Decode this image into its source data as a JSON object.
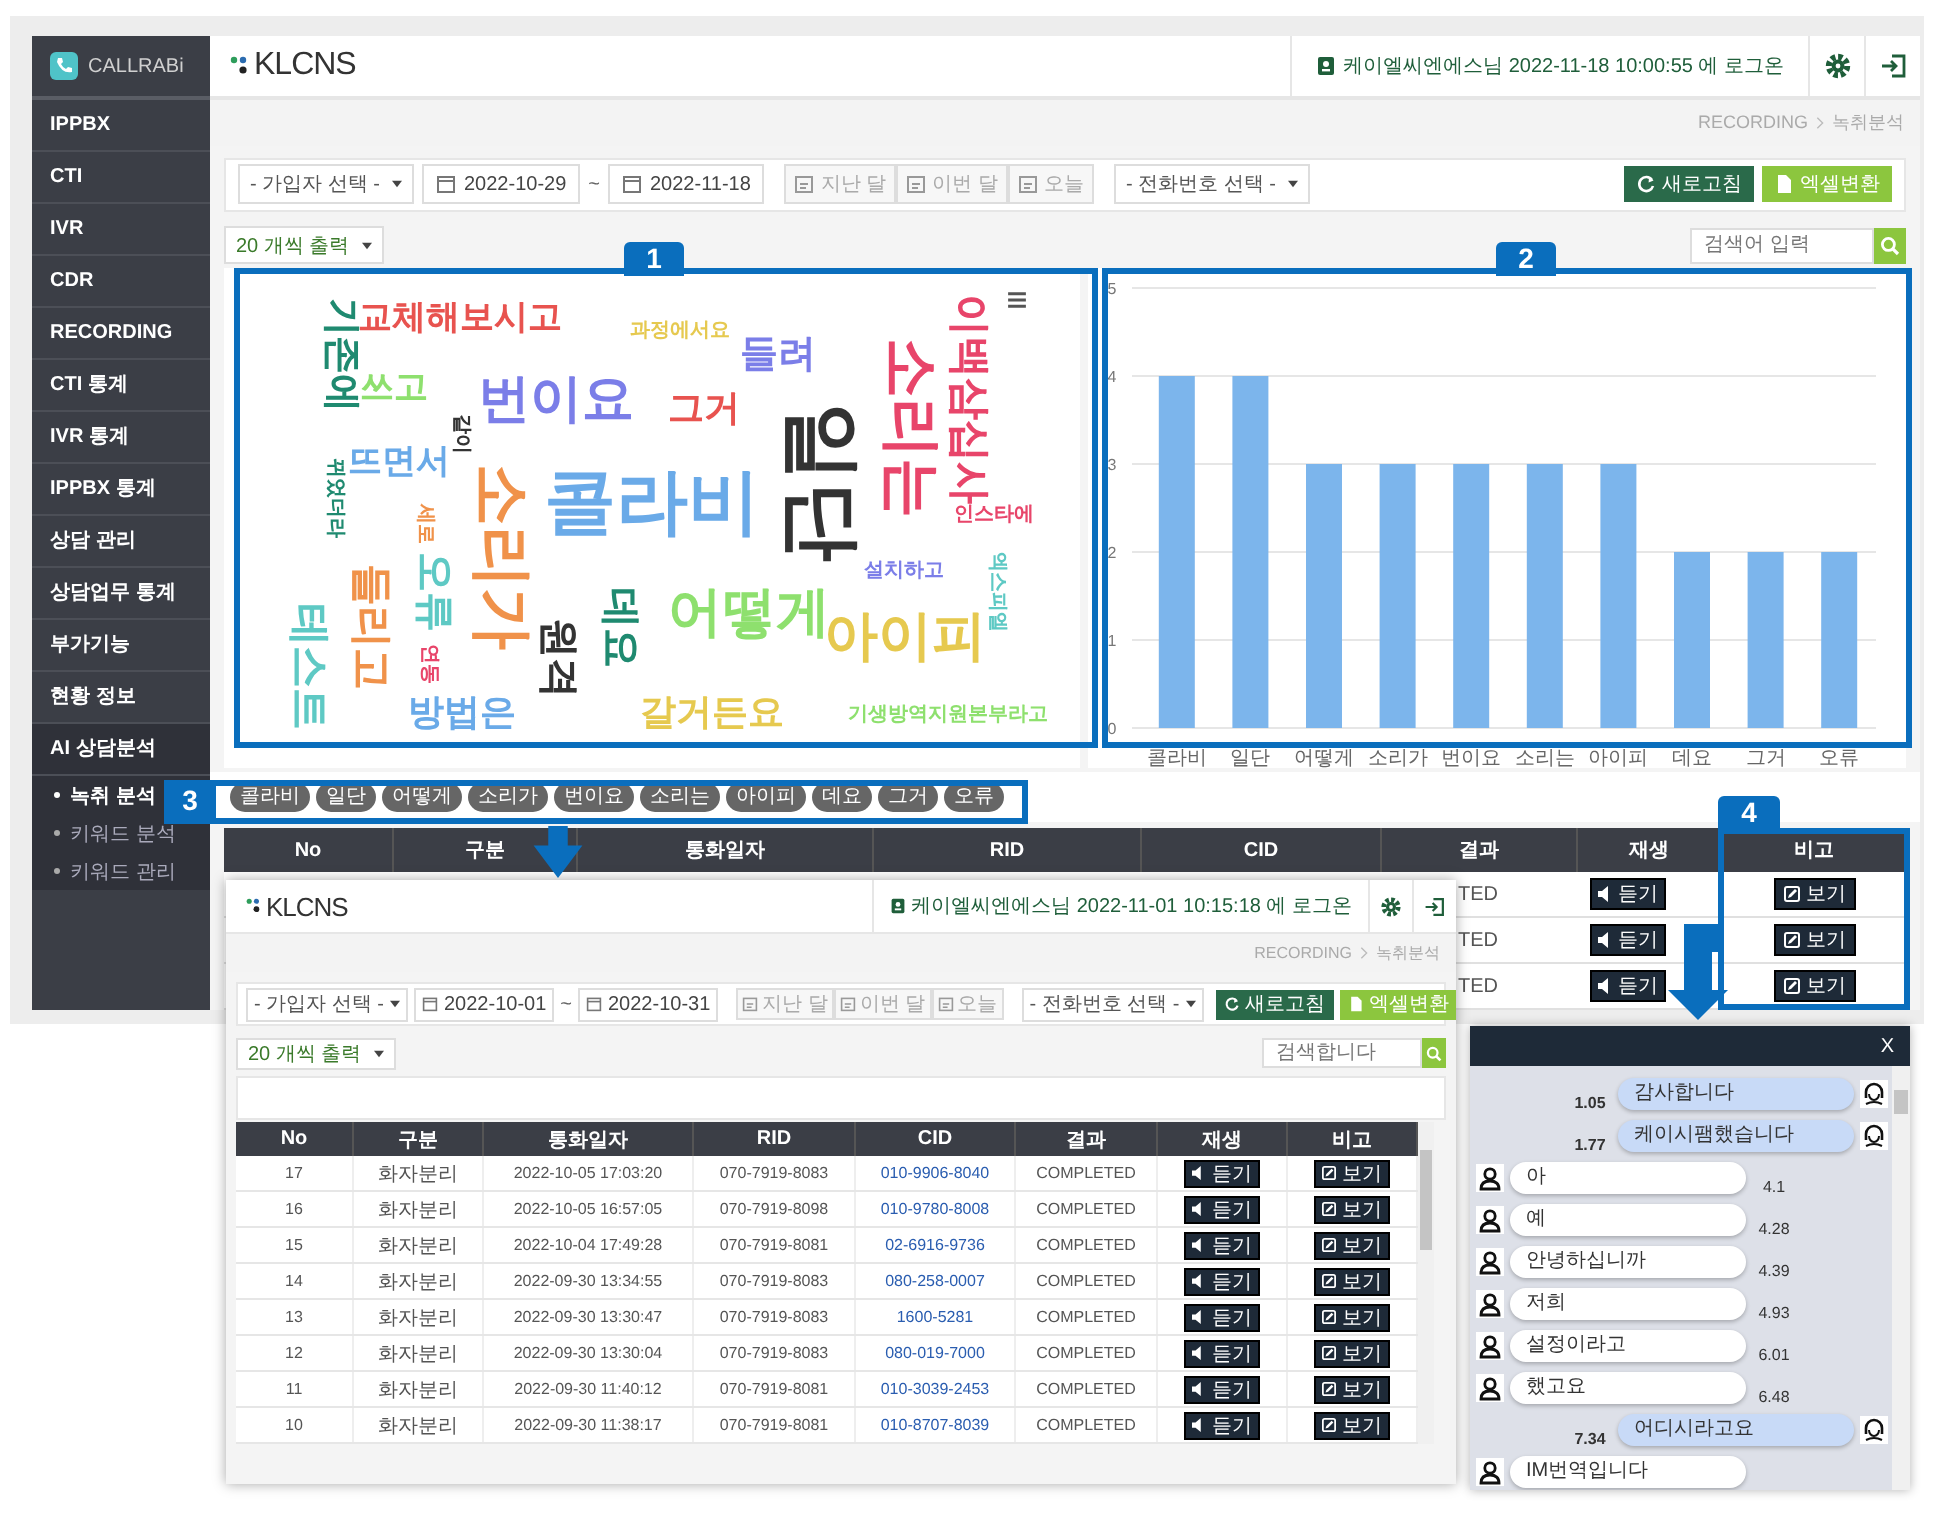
{
  "sidebar": {
    "brand": "CALLRABi",
    "items": [
      {
        "label": "IPPBX",
        "expanded": false
      },
      {
        "label": "CTI",
        "expanded": false
      },
      {
        "label": "IVR",
        "expanded": false
      },
      {
        "label": "CDR",
        "expanded": false
      },
      {
        "label": "RECORDING",
        "expanded": false
      },
      {
        "label": "CTI 통계",
        "expanded": false
      },
      {
        "label": "IVR 통계",
        "expanded": false
      },
      {
        "label": "IPPBX 통계",
        "expanded": false
      },
      {
        "label": "상담 관리",
        "expanded": false
      },
      {
        "label": "상담업무 통계",
        "expanded": false
      },
      {
        "label": "부가기능",
        "expanded": false
      },
      {
        "label": "현황 정보",
        "expanded": false
      },
      {
        "label": "AI 상담분석",
        "expanded": true,
        "children": [
          {
            "label": "녹취 분석",
            "selected": true
          },
          {
            "label": "키워드 분석",
            "selected": false
          },
          {
            "label": "키워드 관리",
            "selected": false
          }
        ]
      }
    ]
  },
  "header": {
    "logo": "KLCNS",
    "user": "케이엘씨엔에스님 2022-11-18 10:00:55 에 로그온"
  },
  "breadcrumb": [
    "RECORDING",
    "녹취분석"
  ],
  "filters": {
    "member_select": "- 가입자 선택 -",
    "date_from": "2022-10-29",
    "date_sep": "~",
    "date_to": "2022-11-18",
    "quick_buttons": [
      "지난 달",
      "이번 달",
      "오늘"
    ],
    "phone_select": "- 전화번호 선택 -",
    "refresh": "새로고침",
    "excel": "엑셀변환"
  },
  "page_size": "20 개씩 출력",
  "search": {
    "placeholder": "검색어 입력"
  },
  "word_cloud": {
    "words": [
      {
        "text": "교체해보시고",
        "color": "#e8534f",
        "vertical": false
      },
      {
        "text": "기존에",
        "color": "#1f8a70",
        "vertical": true
      },
      {
        "text": "쓰고",
        "color": "#8ee06e",
        "vertical": false
      },
      {
        "text": "번이요",
        "color": "#7b7ee8",
        "vertical": false
      },
      {
        "text": "과정에서요",
        "color": "#e6c94f",
        "vertical": false
      },
      {
        "text": "그거",
        "color": "#e8534f",
        "vertical": false
      },
      {
        "text": "들려",
        "color": "#7b7ee8",
        "vertical": false
      },
      {
        "text": "이백삼십사",
        "color": "#e8456a",
        "vertical": true
      },
      {
        "text": "소리는",
        "color": "#e8456a",
        "vertical": true
      },
      {
        "text": "일단",
        "color": "#333333",
        "vertical": true
      },
      {
        "text": "콜라비",
        "color": "#6aaae8",
        "vertical": false
      },
      {
        "text": "같이",
        "color": "#333333",
        "vertical": true
      },
      {
        "text": "뜨면서",
        "color": "#6aaae8",
        "vertical": false
      },
      {
        "text": "뀌었더라",
        "color": "#1f8a70",
        "vertical": true
      },
      {
        "text": "소리가",
        "color": "#f0924a",
        "vertical": true
      },
      {
        "text": "세로",
        "color": "#f0924a",
        "vertical": true
      },
      {
        "text": "오류",
        "color": "#5ec9c4",
        "vertical": true
      },
      {
        "text": "들리고",
        "color": "#f0924a",
        "vertical": true
      },
      {
        "text": "테스트",
        "color": "#5ec9c4",
        "vertical": true
      },
      {
        "text": "연동",
        "color": "#e8456a",
        "vertical": true
      },
      {
        "text": "방법은",
        "color": "#6aaae8",
        "vertical": false
      },
      {
        "text": "원격",
        "color": "#333333",
        "vertical": true
      },
      {
        "text": "데요",
        "color": "#1f8a70",
        "vertical": true
      },
      {
        "text": "어떻게",
        "color": "#8ee06e",
        "vertical": false
      },
      {
        "text": "아이피",
        "color": "#e6c94f",
        "vertical": false
      },
      {
        "text": "갈거든요",
        "color": "#e6c94f",
        "vertical": false
      },
      {
        "text": "인스타에",
        "color": "#e8456a",
        "vertical": false
      },
      {
        "text": "설치하고",
        "color": "#7b7ee8",
        "vertical": false
      },
      {
        "text": "엑스피엘",
        "color": "#5ec9c4",
        "vertical": true
      },
      {
        "text": "기생방역지원본부라고",
        "color": "#8ee06e",
        "vertical": false
      }
    ]
  },
  "chart": {
    "chart_data": {
      "type": "bar",
      "categories": [
        "콜라비",
        "일단",
        "어떻게",
        "소리가",
        "번이요",
        "소리는",
        "아이피",
        "데요",
        "그거",
        "오류"
      ],
      "series": [
        {
          "color": "#7cb5ec",
          "values": [
            4,
            4,
            3,
            3,
            3,
            3,
            3,
            2,
            2,
            2
          ]
        }
      ],
      "ylim": [
        0,
        5
      ],
      "yticks": [
        0,
        1,
        2,
        3,
        4,
        5
      ],
      "grid": true
    }
  },
  "keywords": [
    "콜라비",
    "일단",
    "어떻게",
    "소리가",
    "번이요",
    "소리는",
    "아이피",
    "데요",
    "그거",
    "오류"
  ],
  "table": {
    "columns": [
      "No",
      "구분",
      "통화일자",
      "RID",
      "CID",
      "결과",
      "재생",
      "비고"
    ],
    "rows": [
      {
        "result": "TED",
        "play": "듣기",
        "note": "보기"
      },
      {
        "result": "TED",
        "play": "듣기",
        "note": "보기"
      },
      {
        "result": "TED",
        "play": "듣기",
        "note": "보기"
      }
    ]
  },
  "callouts": [
    "1",
    "2",
    "3",
    "4"
  ],
  "inset": {
    "logo": "KLCNS",
    "user": "케이엘씨엔에스님 2022-11-01 10:15:18 에 로그온",
    "breadcrumb": [
      "RECORDING",
      "녹취분석"
    ],
    "filters": {
      "member_select": "- 가입자 선택 -",
      "date_from": "2022-10-01",
      "date_sep": "~",
      "date_to": "2022-10-31",
      "quick_buttons": [
        "지난 달",
        "이번 달",
        "오늘"
      ],
      "phone_select": "- 전화번호 선택 -",
      "refresh": "새로고침",
      "excel": "엑셀변환"
    },
    "page_size": "20 개씩 출력",
    "search": {
      "placeholder": "검색합니다"
    },
    "table": {
      "columns": [
        "No",
        "구분",
        "통화일자",
        "RID",
        "CID",
        "결과",
        "재생",
        "비고"
      ],
      "rows": [
        {
          "no": "17",
          "type": "화자분리",
          "date": "2022-10-05 17:03:20",
          "rid": "070-7919-8083",
          "cid": "010-9906-8040",
          "result": "COMPLETED",
          "play": "듣기",
          "note": "보기"
        },
        {
          "no": "16",
          "type": "화자분리",
          "date": "2022-10-05 16:57:05",
          "rid": "070-7919-8098",
          "cid": "010-9780-8008",
          "result": "COMPLETED",
          "play": "듣기",
          "note": "보기"
        },
        {
          "no": "15",
          "type": "화자분리",
          "date": "2022-10-04 17:49:28",
          "rid": "070-7919-8081",
          "cid": "02-6916-9736",
          "result": "COMPLETED",
          "play": "듣기",
          "note": "보기"
        },
        {
          "no": "14",
          "type": "화자분리",
          "date": "2022-09-30 13:34:55",
          "rid": "070-7919-8083",
          "cid": "080-258-0007",
          "result": "COMPLETED",
          "play": "듣기",
          "note": "보기"
        },
        {
          "no": "13",
          "type": "화자분리",
          "date": "2022-09-30 13:30:47",
          "rid": "070-7919-8083",
          "cid": "1600-5281",
          "result": "COMPLETED",
          "play": "듣기",
          "note": "보기"
        },
        {
          "no": "12",
          "type": "화자분리",
          "date": "2022-09-30 13:30:04",
          "rid": "070-7919-8083",
          "cid": "080-019-7000",
          "result": "COMPLETED",
          "play": "듣기",
          "note": "보기"
        },
        {
          "no": "11",
          "type": "화자분리",
          "date": "2022-09-30 11:40:12",
          "rid": "070-7919-8081",
          "cid": "010-3039-2453",
          "result": "COMPLETED",
          "play": "듣기",
          "note": "보기"
        },
        {
          "no": "10",
          "type": "화자분리",
          "date": "2022-09-30 11:38:17",
          "rid": "070-7919-8081",
          "cid": "010-8707-8039",
          "result": "COMPLETED",
          "play": "듣기",
          "note": "보기"
        }
      ]
    }
  },
  "chat": {
    "close": "X",
    "messages": [
      {
        "kind": "agent",
        "text": "감사합니다",
        "time": "1.05"
      },
      {
        "kind": "agent",
        "text": "케이시팸했습니다",
        "time": "1.77"
      },
      {
        "kind": "customer",
        "text": "아",
        "time": "4.1"
      },
      {
        "kind": "customer",
        "text": "예",
        "time": "4.28"
      },
      {
        "kind": "customer",
        "text": "안녕하십니까",
        "time": "4.39"
      },
      {
        "kind": "customer",
        "text": "저희",
        "time": "4.93"
      },
      {
        "kind": "customer",
        "text": "설정이라고",
        "time": "6.01"
      },
      {
        "kind": "customer",
        "text": "했고요",
        "time": "6.48"
      },
      {
        "kind": "agent",
        "text": "어디시라고요",
        "time": "7.34"
      },
      {
        "kind": "customer",
        "text": "IM번역입니다"
      }
    ]
  }
}
